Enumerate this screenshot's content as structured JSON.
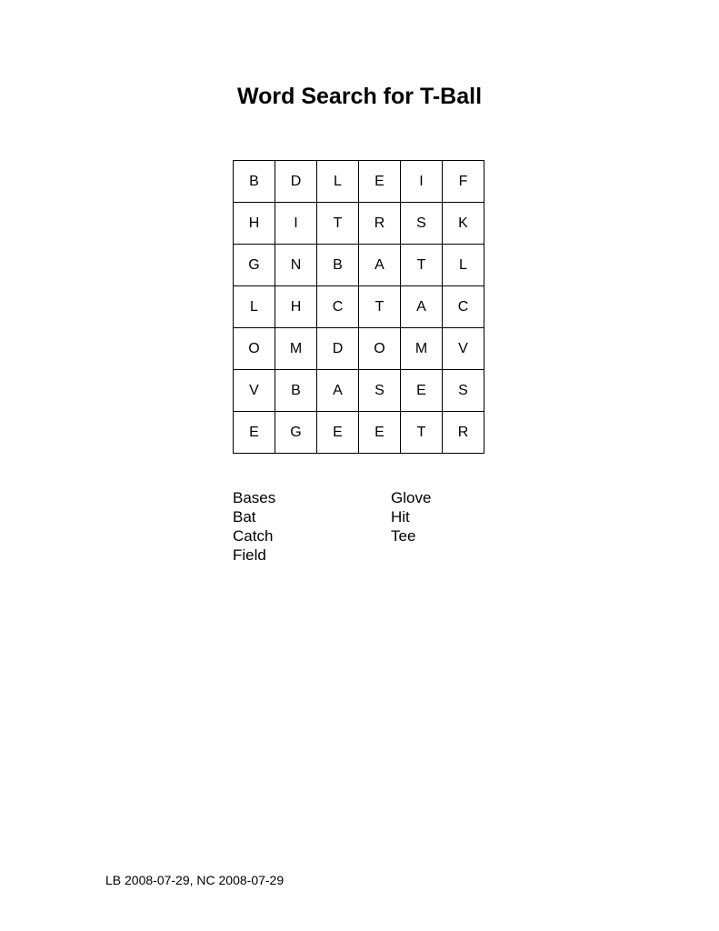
{
  "title": "Word Search for T-Ball",
  "grid": [
    [
      "B",
      "D",
      "L",
      "E",
      "I",
      "F"
    ],
    [
      "H",
      "I",
      "T",
      "R",
      "S",
      "K"
    ],
    [
      "G",
      "N",
      "B",
      "A",
      "T",
      "L"
    ],
    [
      "L",
      "H",
      "C",
      "T",
      "A",
      "C"
    ],
    [
      "O",
      "M",
      "D",
      "O",
      "M",
      "V"
    ],
    [
      "V",
      "B",
      "A",
      "S",
      "E",
      "S"
    ],
    [
      "E",
      "G",
      "E",
      "E",
      "T",
      "R"
    ]
  ],
  "words": {
    "column_1": [
      "Bases",
      "Bat",
      "Catch",
      "Field"
    ],
    "column_2": [
      "Glove",
      "Hit",
      "Tee"
    ]
  },
  "footer": "LB 2008-07-29, NC 2008-07-29"
}
